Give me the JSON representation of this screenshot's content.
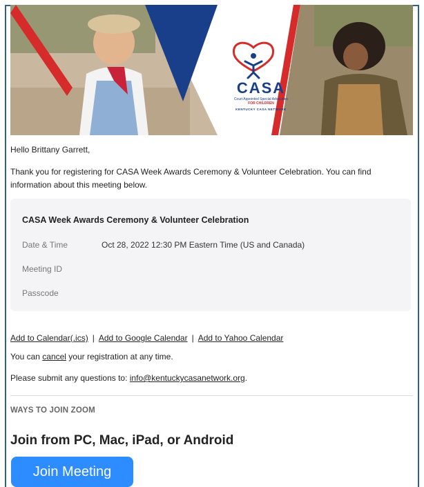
{
  "banner": {
    "logo_word": "CASA",
    "logo_sub": "Court Appointed Special Advocates",
    "logo_sub2": "FOR CHILDREN",
    "logo_network": "KENTUCKY CASA NETWORK",
    "colors": {
      "navy": "#1a3f8a",
      "red": "#d62b2b"
    }
  },
  "greeting": "Hello Brittany Garrett,",
  "thanks": "Thank you for registering for CASA Week Awards Ceremony & Volunteer Celebration. You can find information about this meeting below.",
  "meeting": {
    "title": "CASA Week Awards Ceremony & Volunteer Celebration",
    "rows": [
      {
        "label": "Date & Time",
        "value": "Oct 28, 2022 12:30 PM Eastern Time (US and Canada)"
      },
      {
        "label": "Meeting ID",
        "value": ""
      },
      {
        "label": "Passcode",
        "value": ""
      }
    ]
  },
  "calendar_links": {
    "ics": "Add to Calendar(.ics)",
    "google": "Add to Google Calendar",
    "yahoo": "Add to Yahoo Calendar",
    "separator": "|"
  },
  "cancel": {
    "prefix": "You can ",
    "link": "cancel",
    "suffix": " your registration at any time."
  },
  "questions": {
    "prefix": "Please submit any questions to: ",
    "email": "info@kentuckycasanetwork.org",
    "suffix": "."
  },
  "ways_heading": "WAYS TO JOIN ZOOM",
  "join_heading": "Join from PC, Mac, iPad, or Android",
  "join_button": "Join Meeting",
  "accent_color": "#2d8cff"
}
